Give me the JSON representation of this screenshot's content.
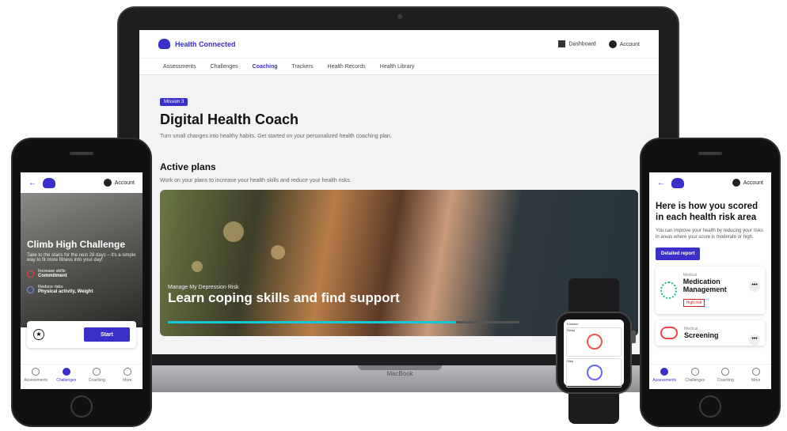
{
  "desktop": {
    "brand": "Health Connected",
    "top_links": [
      "Dashboard",
      "Account"
    ],
    "nav_tabs": [
      "Assessments",
      "Challenges",
      "Coaching",
      "Trackers",
      "Health Records",
      "Health Library"
    ],
    "active_tab_index": 2,
    "badge": "Mission 3",
    "page_title": "Digital Health Coach",
    "page_subtitle": "Turn small changes into healthy habits. Get started on your personalized health coaching plan.",
    "section_title": "Active plans",
    "section_subtitle": "Work on your plans to increase your health skills and reduce your health risks.",
    "hero": {
      "eyebrow": "Manage My Depression Risk",
      "title": "Learn coping skills and find support",
      "progress": 0.82
    },
    "device_label": "MacBook"
  },
  "left_phone": {
    "account": "Account",
    "challenge_title": "Climb High Challenge",
    "challenge_desc": "Take to the stairs for the next 28 days – it's a simple way to fit more fitness into your day!",
    "rows": [
      {
        "label": "Increase skills",
        "value": "Commitment"
      },
      {
        "label": "Reduce risks",
        "value": "Physical activity, Weight"
      }
    ],
    "start_label": "Start",
    "nav": [
      "Assessments",
      "Challenges",
      "Coaching",
      "More"
    ],
    "nav_active": 1
  },
  "right_phone": {
    "account": "Account",
    "title": "Here is how you scored in each health risk area",
    "desc": "You can improve your health by reducing your risks in areas where your score is moderate or high.",
    "button": "Detailed report",
    "cards": [
      {
        "category": "Medical",
        "name": "Medication Management",
        "risk": "High risk"
      },
      {
        "category": "Medical",
        "name": "Screening"
      }
    ],
    "more_label": "•••",
    "nav": [
      "Assessments",
      "Challenges",
      "Coaching",
      "More"
    ],
    "nav_active": 0
  },
  "watch": {
    "header": "Trackers",
    "cards": [
      "Sleep",
      "Step"
    ]
  }
}
